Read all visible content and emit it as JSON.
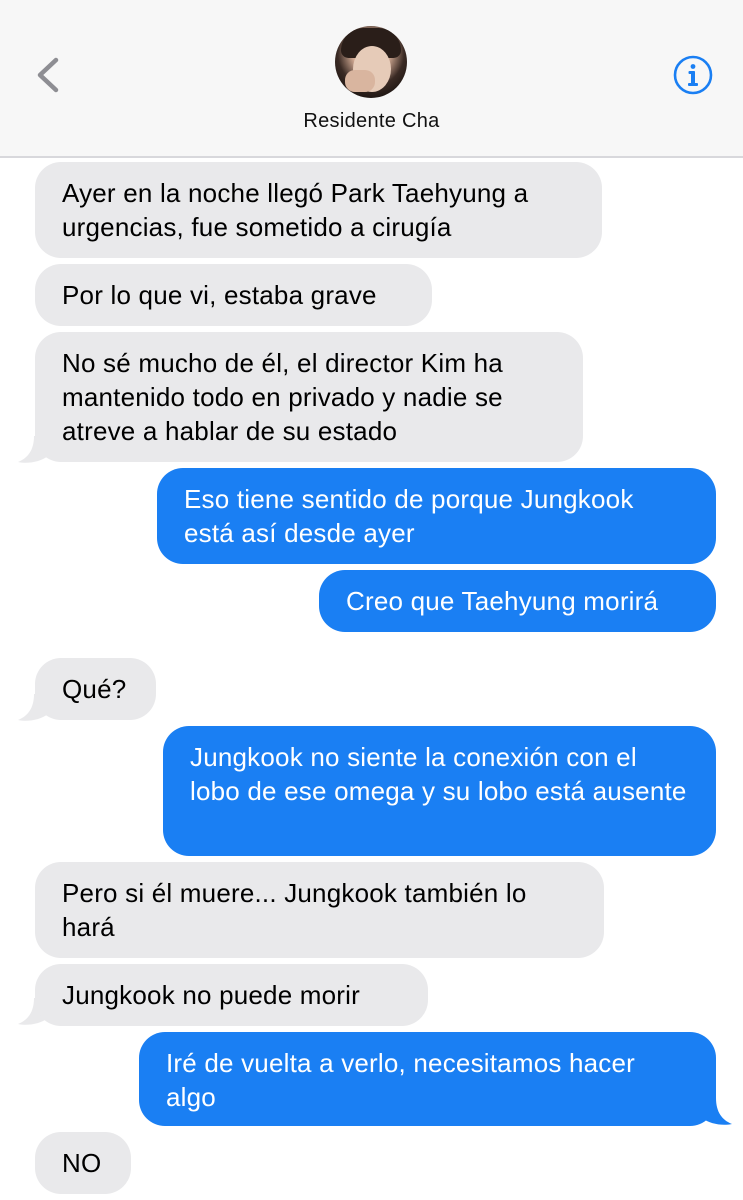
{
  "header": {
    "contact_name": "Residente Cha"
  },
  "colors": {
    "incoming_bubble": "#e9e9eb",
    "outgoing_bubble": "#1a7ff3",
    "accent": "#1a7ff3"
  },
  "icons": {
    "back": "chevron-left-icon",
    "info": "info-circle-icon"
  },
  "messages": [
    {
      "direction": "incoming",
      "text": "Ayer en la noche llegó Park Taehyung a urgencias, fue sometido a cirugía"
    },
    {
      "direction": "incoming",
      "text": "Por lo que vi, estaba grave"
    },
    {
      "direction": "incoming",
      "text": "No sé mucho de él, el director Kim ha mantenido todo en privado y nadie se atreve a hablar de su estado"
    },
    {
      "direction": "outgoing",
      "text": "Eso tiene sentido de porque Jungkook está así desde ayer"
    },
    {
      "direction": "outgoing",
      "text": "Creo que Taehyung morirá"
    },
    {
      "direction": "incoming",
      "text": "Qué?"
    },
    {
      "direction": "outgoing",
      "text": "Jungkook no siente la conexión con el lobo de ese omega y su lobo está ausente"
    },
    {
      "direction": "incoming",
      "text": "Pero si él muere... Jungkook también lo hará"
    },
    {
      "direction": "incoming",
      "text": "Jungkook no puede morir"
    },
    {
      "direction": "outgoing",
      "text": "Iré de vuelta a verlo, necesitamos hacer algo"
    },
    {
      "direction": "incoming",
      "text": "NO"
    }
  ]
}
